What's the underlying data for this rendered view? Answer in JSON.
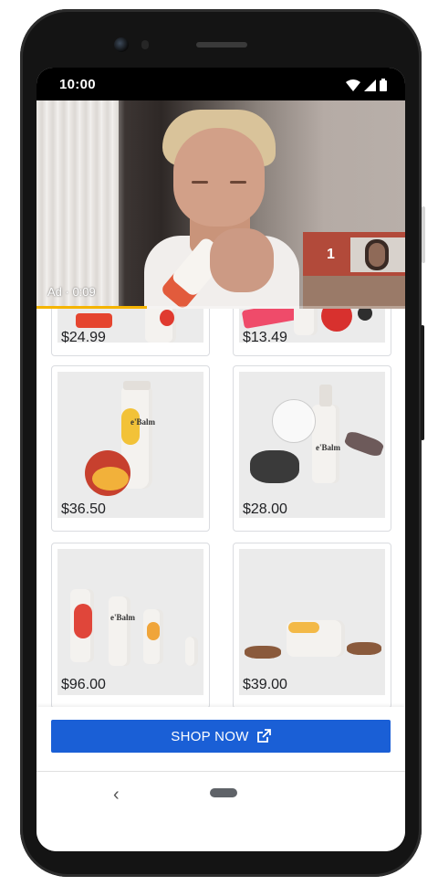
{
  "status_bar": {
    "time": "10:00",
    "icons": [
      "wifi-icon",
      "signal-icon",
      "battery-icon"
    ]
  },
  "video_ad": {
    "ad_label": "Ad · 0:09",
    "up_next_count": "1",
    "progress_fraction": 0.3
  },
  "products": [
    {
      "price": "$24.99"
    },
    {
      "price": "$13.49"
    },
    {
      "price": "$36.50",
      "brand": "e'Balm"
    },
    {
      "price": "$28.00",
      "brand": "e'Balm"
    },
    {
      "price": "$96.00",
      "brand": "e'Balm"
    },
    {
      "price": "$39.00"
    }
  ],
  "cta": {
    "label": "SHOP NOW",
    "icon": "open-in-new-icon",
    "color": "#1a5fd6"
  },
  "nav": {
    "back_icon": "chevron-left-icon",
    "home_icon": "home-pill-icon"
  }
}
